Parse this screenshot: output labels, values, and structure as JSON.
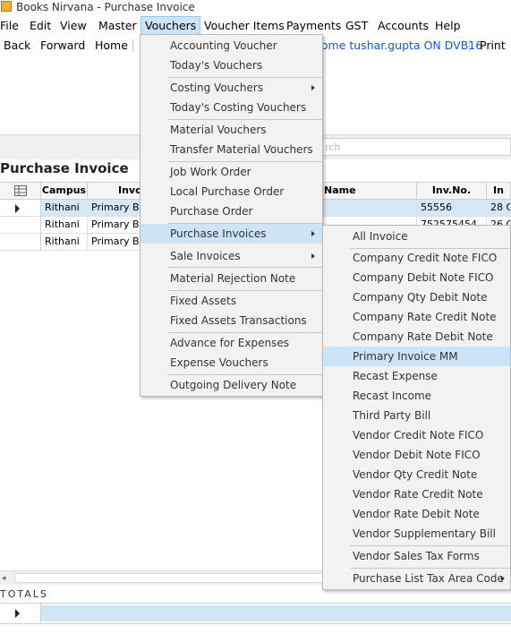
{
  "window": {
    "title": "Books Nirvana - Purchase Invoice",
    "icon": "app-logo-icon"
  },
  "menubar": {
    "items": [
      "File",
      "Edit",
      "View",
      "Master",
      "Vouchers",
      "Voucher Items",
      "Payments",
      "GST",
      "Accounts",
      "Help"
    ],
    "active": "Vouchers"
  },
  "toolbar": {
    "back": "Back",
    "forward": "Forward",
    "home": "Home",
    "welcome": "come tushar.gupta ON DVB16",
    "print": "Print"
  },
  "search": {
    "placeholder": "rch"
  },
  "page": {
    "title": "Purchase Invoice"
  },
  "grid": {
    "columns": [
      "Campus",
      "Invo",
      "Name",
      "Inv.No.",
      "In"
    ],
    "rows": [
      {
        "campus": "Rithani",
        "invoice": "Primary Bi",
        "inv_no": "55556",
        "in": "28 O",
        "selected": true
      },
      {
        "campus": "Rithani",
        "invoice": "Primary Bi",
        "inv_no": "752575454",
        "in": "26 O"
      },
      {
        "campus": "Rithani",
        "invoice": "Primary Bi",
        "inv_no": "",
        "in": ""
      }
    ]
  },
  "totals": {
    "label": "TOTALS"
  },
  "vouchers_menu": {
    "items": [
      "Accounting Voucher",
      "Today's Vouchers",
      "Costing Vouchers",
      "Today's Costing Vouchers",
      "Material Vouchers",
      "Transfer Material Vouchers",
      "Job Work Order",
      "Local Purchase Order",
      "Purchase Order",
      "Purchase Invoices",
      "Sale Invoices",
      "Material Rejection Note",
      "Fixed Assets",
      "Fixed Assets Transactions",
      "Advance for Expenses",
      "Expense Vouchers",
      "Outgoing Delivery Note"
    ],
    "highlighted": "Purchase Invoices"
  },
  "purchase_invoices_submenu": {
    "items": [
      "All Invoice",
      "Company Credit Note FICO",
      "Company Debit Note FICO",
      "Company Qty Debit Note",
      "Company Rate Credit Note",
      "Company Rate Debit Note",
      "Primary Invoice MM",
      "Recast Expense",
      "Recast Income",
      "Third Party Bill",
      "Vendor Credit Note FICO",
      "Vendor Debit Note FICO",
      "Vendor Qty Credit Note",
      "Vendor Rate Credit Note",
      "Vendor Rate Debit Note",
      "Vendor Supplementary Bill",
      "Vendor Sales Tax Forms",
      "Purchase List Tax Area Code"
    ],
    "highlighted": "Primary Invoice MM"
  },
  "colors": {
    "highlight": "#cce4f7",
    "link": "#1a55c9",
    "menu_bg": "#f2f2f2"
  }
}
